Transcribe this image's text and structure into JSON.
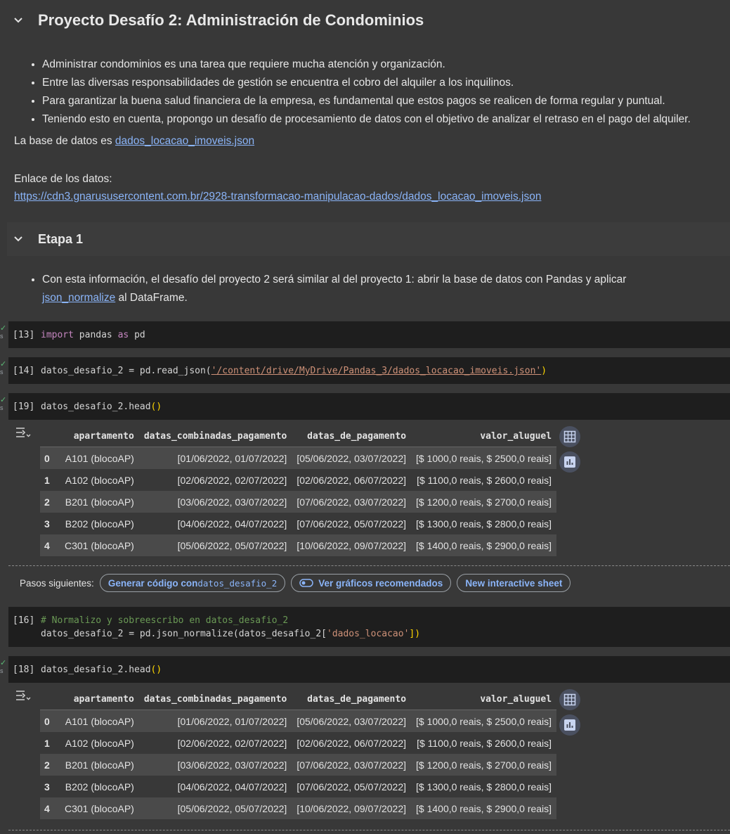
{
  "section1": {
    "title": "Proyecto Desafío 2: Administración de Condominios",
    "bullets": [
      "Administrar condominios es una tarea que requiere mucha atención y organización.",
      "Entre las diversas responsabilidades de gestión se encuentra el cobro del alquiler a los inquilinos.",
      "Para garantizar la buena salud financiera de la empresa, es fundamental que estos pagos se realicen de forma regular y puntual.",
      "Teniendo esto en cuenta, propongo un desafío de procesamiento de datos con el objetivo de analizar el retraso en el pago del alquiler."
    ],
    "db_prefix": "La base de datos es ",
    "db_link": "dados_locacao_imoveis.json",
    "link_label": "Enlace de los datos:",
    "link_url": "https://cdn3.gnarususercontent.com.br/2928-transformacao-manipulacao-dados/dados_locacao_imoveis.json"
  },
  "section2": {
    "title": "Etapa 1",
    "bullet_text": "Con esta información, el desafío del proyecto 2 será similar al del proyecto 1: abrir la base de datos con Pandas y aplicar",
    "bullet_link": "json_normalize",
    "bullet_suffix": " al DataFrame."
  },
  "cells": {
    "c13": {
      "prompt": "[13]",
      "kw1": "import",
      "mid": " pandas ",
      "kw2": "as",
      "end": " pd"
    },
    "c14": {
      "prompt": "[14]",
      "pre": "datos_desafio_2 = pd.read_json(",
      "str": "'/content/drive/MyDrive/Pandas_3/dados_locacao_imoveis.json'",
      "post": ")"
    },
    "c19": {
      "prompt": "[19]",
      "pre": "datos_desafio_2.head",
      "paren": "()"
    },
    "c16": {
      "prompt": "[16]",
      "comment": "# Normalizo y sobreescribo en datos_desafio_2",
      "pre": "datos_desafio_2 = pd.json_normalize(datos_desafio_2[",
      "str": "'dados_locacao'",
      "post": "])"
    },
    "c18": {
      "prompt": "[18]",
      "pre": "datos_desafio_2.head",
      "paren": "()"
    }
  },
  "table": {
    "columns": [
      "",
      "apartamento",
      "datas_combinadas_pagamento",
      "datas_de_pagamento",
      "valor_aluguel"
    ],
    "rows": [
      [
        "0",
        "A101 (blocoAP)",
        "[01/06/2022, 01/07/2022]",
        "[05/06/2022, 03/07/2022]",
        "[$ 1000,0 reais, $ 2500,0 reais]"
      ],
      [
        "1",
        "A102 (blocoAP)",
        "[02/06/2022, 02/07/2022]",
        "[02/06/2022, 06/07/2022]",
        "[$ 1100,0 reais, $ 2600,0 reais]"
      ],
      [
        "2",
        "B201 (blocoAP)",
        "[03/06/2022, 03/07/2022]",
        "[07/06/2022, 03/07/2022]",
        "[$ 1200,0 reais, $ 2700,0 reais]"
      ],
      [
        "3",
        "B202 (blocoAP)",
        "[04/06/2022, 04/07/2022]",
        "[07/06/2022, 05/07/2022]",
        "[$ 1300,0 reais, $ 2800,0 reais]"
      ],
      [
        "4",
        "C301 (blocoAP)",
        "[05/06/2022, 05/07/2022]",
        "[10/06/2022, 09/07/2022]",
        "[$ 1400,0 reais, $ 2900,0 reais]"
      ]
    ]
  },
  "next_steps": {
    "label": "Pasos siguientes:",
    "chip1_text": "Generar código con ",
    "chip1_var": "datos_desafio_2",
    "chip2": "Ver gráficos recomendados",
    "chip3": "New interactive sheet"
  },
  "status_suffix": "s",
  "colors": {
    "link": "#8ab4f8",
    "keyword": "#c586c0",
    "string": "#ce9178",
    "comment": "#6a9955",
    "check": "#5bb974"
  }
}
